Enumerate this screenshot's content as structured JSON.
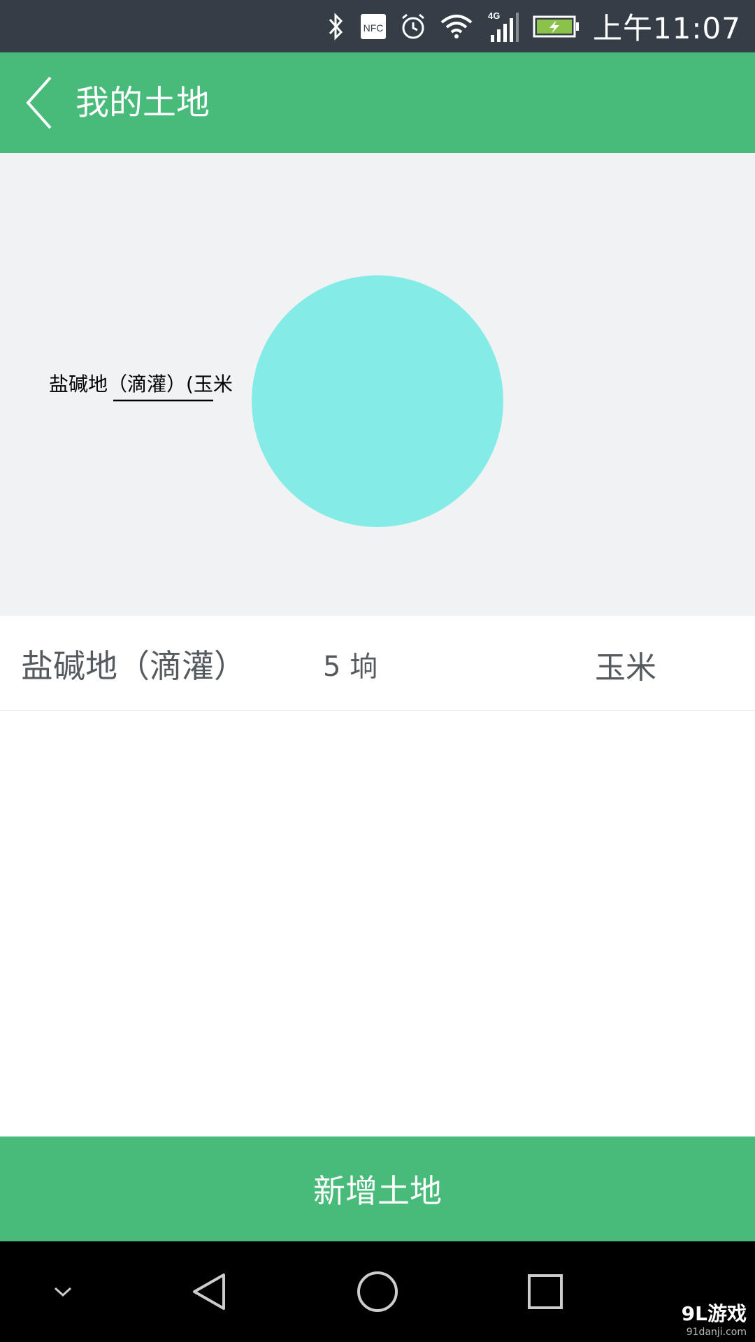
{
  "status_bar": {
    "time": "上午11:07",
    "network_label": "4G",
    "nfc_label": "NFC",
    "icons": [
      "bluetooth-icon",
      "nfc-icon",
      "alarm-icon",
      "wifi-icon",
      "signal-icon",
      "battery-icon"
    ]
  },
  "app_bar": {
    "title": "我的土地"
  },
  "chart_data": {
    "type": "pie",
    "slices": [
      {
        "label": "盐碱地（滴灌）(玉米",
        "value": 5,
        "color": "#84ebe6"
      }
    ]
  },
  "land_list": [
    {
      "name": "盐碱地（滴灌）",
      "area": "5 垧",
      "crop": "玉米"
    }
  ],
  "add_button": {
    "label": "新增土地"
  },
  "watermark": {
    "main": "9L游戏",
    "sub": "91danji.com"
  },
  "colors": {
    "primary": "#48ba79",
    "status_bar": "#353e46",
    "chart_bg": "#f0f2f3",
    "slice": "#84ebe6"
  }
}
